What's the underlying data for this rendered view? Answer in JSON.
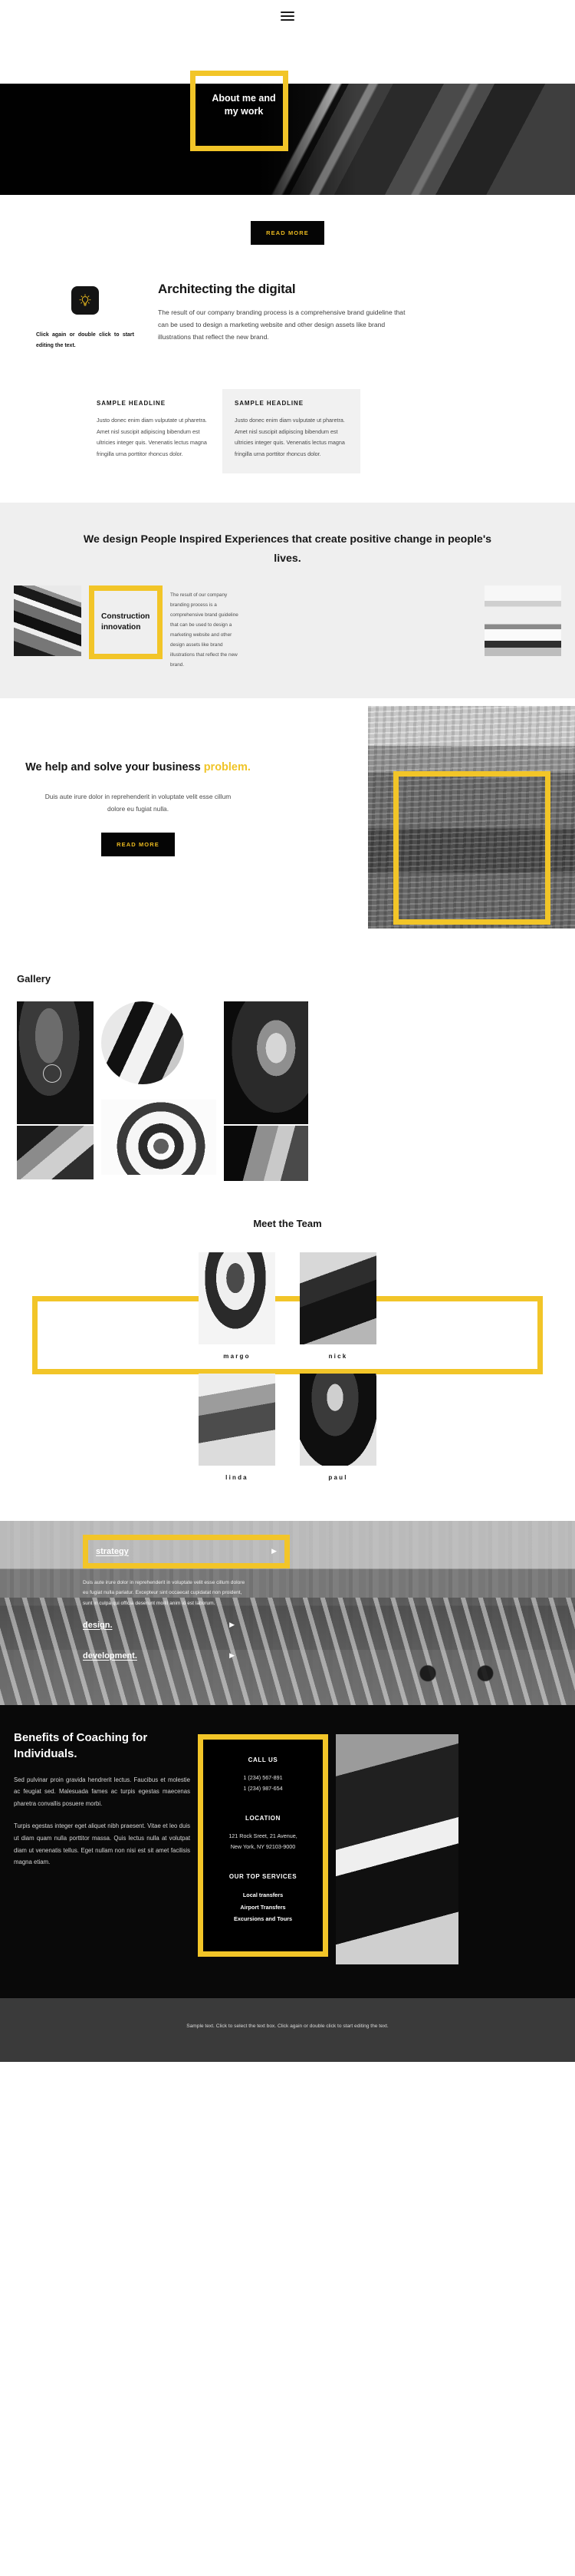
{
  "nav": {
    "menu_icon": "hamburger-menu-icon"
  },
  "hero": {
    "title": "About me and my work",
    "read_more": "READ MORE"
  },
  "architecting": {
    "icon": "lightbulb-icon",
    "caption": "Click again or double click to start editing the text.",
    "heading": "Architecting the digital",
    "paragraph": "The result of our company branding process is a comprehensive brand guideline that can be used to design a marketing website and other design assets like brand illustrations that reflect the new brand.",
    "columns": [
      {
        "headline": "SAMPLE HEADLINE",
        "body": "Justo donec enim diam vulputate ut pharetra. Amet nisl suscipit adipiscing bibendum est ultricies integer quis. Venenatis lectus magna fringilla urna porttitor rhoncus dolor."
      },
      {
        "headline": "SAMPLE HEADLINE",
        "body": "Justo donec enim diam vulputate ut pharetra. Amet nisl suscipit adipiscing bibendum est ultricies integer quis. Venenatis lectus magna fringilla urna porttitor rhoncus dolor."
      }
    ]
  },
  "inspired": {
    "heading": "We design People Inspired Experiences that create positive change in people's lives.",
    "card_title": "Construction innovation",
    "body": "The result of our company branding process is a comprehensive brand guideline that can be used to design a marketing website and other design assets like brand illustrations that reflect the new brand."
  },
  "solve": {
    "heading_part1": "We help and solve your business ",
    "heading_accent": "problem.",
    "paragraph": "Duis aute irure dolor in reprehenderit in voluptate velit esse cillum dolore eu fugiat nulla.",
    "read_more": "READ MORE"
  },
  "gallery": {
    "heading": "Gallery"
  },
  "team": {
    "heading": "Meet the Team",
    "members": [
      {
        "name": "margo"
      },
      {
        "name": "nick"
      },
      {
        "name": "linda"
      },
      {
        "name": "paul"
      }
    ]
  },
  "services": {
    "items": [
      {
        "label": "strategy",
        "arrow": "play-arrow-icon",
        "body": "Duis aute irure dolor in reprehenderit in voluptate velit esse cillum dolore eu fugiat nulla pariatur. Excepteur sint occaecat cupidatat non proident, sunt in culpa qui officia deserunt mollit anim id est laborum."
      },
      {
        "label": "design.",
        "arrow": "play-arrow-icon",
        "body": ""
      },
      {
        "label": "development.",
        "arrow": "play-arrow-icon",
        "body": ""
      }
    ]
  },
  "benefits": {
    "heading": "Benefits of Coaching for Individuals.",
    "paragraph1": "Sed pulvinar proin gravida hendrerit lectus. Faucibus et molestie ac feugiat sed. Malesuada fames ac turpis egestas maecenas pharetra convallis posuere morbi.",
    "paragraph2": "Turpis egestas integer eget aliquet nibh praesent. Vitae et leo duis ut diam quam nulla porttitor massa. Quis lectus nulla at volutpat diam ut venenatis tellus. Eget nullam non nisi est sit amet facilisis magna etiam."
  },
  "contact": {
    "call_heading": "CALL US",
    "phone1": "1 (234) 567-891",
    "phone2": "1 (234) 987-654",
    "location_heading": "LOCATION",
    "address1": "121 Rock Sreet, 21 Avenue,",
    "address2": "New York, NY 92103-9000",
    "services_heading": "OUR TOP SERVICES",
    "service1": "Local transfers",
    "service2": "Airport Transfers",
    "service3": "Excursions and Tours"
  },
  "footer": {
    "text": "Sample text. Click to select the text box. Click again or double click to start editing the text."
  },
  "colors": {
    "accent_yellow": "#F2C528",
    "button_text": "#E9B81F",
    "dark": "#090909",
    "grey_section": "#efefef",
    "footer_bg": "#3a3a3a"
  }
}
